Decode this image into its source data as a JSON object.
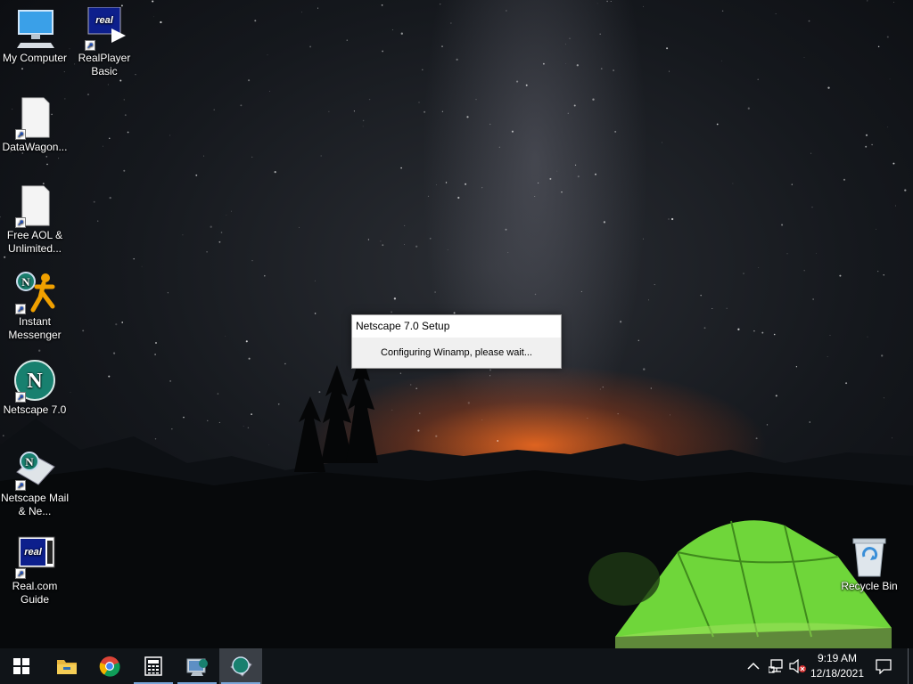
{
  "desktop": {
    "icons": [
      {
        "label": "My Computer"
      },
      {
        "label": "RealPlayer Basic",
        "logo_text": "real"
      },
      {
        "label": "DataWagon..."
      },
      {
        "label": "Free AOL & Unlimited..."
      },
      {
        "label": "Instant Messenger",
        "badge_letter": "N"
      },
      {
        "label": "Netscape 7.0",
        "logo_letter": "N"
      },
      {
        "label": "Netscape Mail & Ne...",
        "badge_letter": "N"
      },
      {
        "label": "Real.com Guide",
        "logo_text": "real"
      },
      {
        "label": "Recycle Bin"
      }
    ]
  },
  "dialog": {
    "title": "Netscape 7.0 Setup",
    "message": "Configuring Winamp, please wait..."
  },
  "taskbar": {
    "items": [
      {
        "icon": "windows-start-icon"
      },
      {
        "icon": "file-explorer-icon"
      },
      {
        "icon": "chrome-icon"
      },
      {
        "icon": "calculator-icon"
      },
      {
        "icon": "netscape-setup-icon"
      },
      {
        "icon": "netscape-icon",
        "active": true
      }
    ],
    "tray_icons": [
      "chevron-up-icon",
      "network-icon",
      "volume-muted-icon"
    ],
    "clock": {
      "time": "9:19 AM",
      "date": "12/18/2021"
    },
    "notification_icon": "action-center-icon",
    "accent_color": "#7aa6d8"
  }
}
